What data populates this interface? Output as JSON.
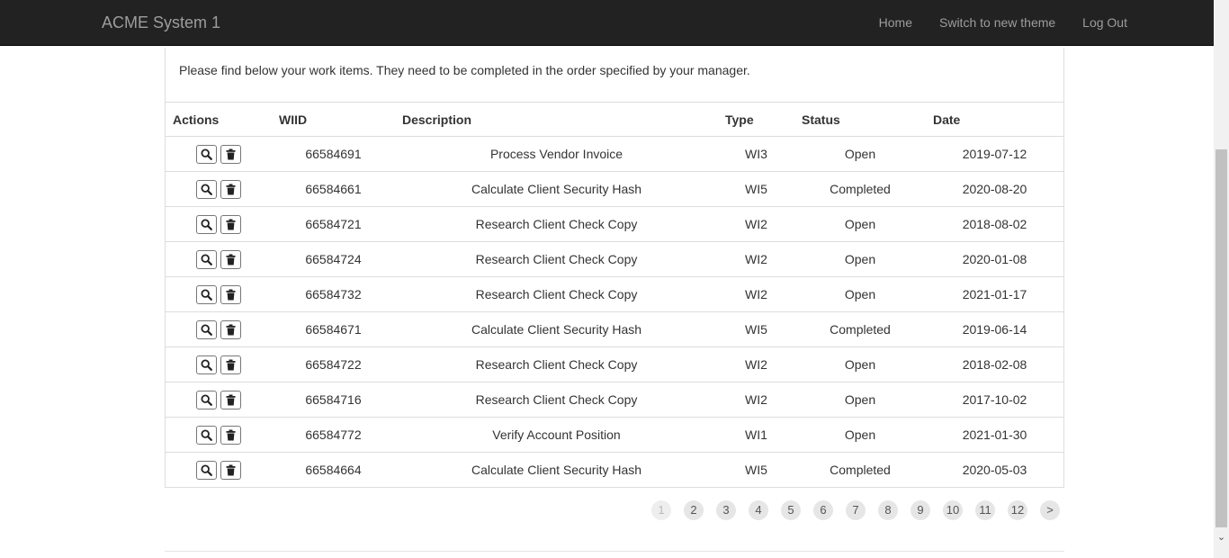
{
  "nav": {
    "brand": "ACME System 1",
    "links": [
      "Home",
      "Switch to new theme",
      "Log Out"
    ]
  },
  "intro": "Please find below your work items. They need to be completed in the order specified by your manager.",
  "table": {
    "headers": [
      "Actions",
      "WIID",
      "Description",
      "Type",
      "Status",
      "Date"
    ],
    "rows": [
      {
        "wiid": "66584691",
        "description": "Process Vendor Invoice",
        "type": "WI3",
        "status": "Open",
        "date": "2019-07-12"
      },
      {
        "wiid": "66584661",
        "description": "Calculate Client Security Hash",
        "type": "WI5",
        "status": "Completed",
        "date": "2020-08-20"
      },
      {
        "wiid": "66584721",
        "description": "Research Client Check Copy",
        "type": "WI2",
        "status": "Open",
        "date": "2018-08-02"
      },
      {
        "wiid": "66584724",
        "description": "Research Client Check Copy",
        "type": "WI2",
        "status": "Open",
        "date": "2020-01-08"
      },
      {
        "wiid": "66584732",
        "description": "Research Client Check Copy",
        "type": "WI2",
        "status": "Open",
        "date": "2021-01-17"
      },
      {
        "wiid": "66584671",
        "description": "Calculate Client Security Hash",
        "type": "WI5",
        "status": "Completed",
        "date": "2019-06-14"
      },
      {
        "wiid": "66584722",
        "description": "Research Client Check Copy",
        "type": "WI2",
        "status": "Open",
        "date": "2018-02-08"
      },
      {
        "wiid": "66584716",
        "description": "Research Client Check Copy",
        "type": "WI2",
        "status": "Open",
        "date": "2017-10-02"
      },
      {
        "wiid": "66584772",
        "description": "Verify Account Position",
        "type": "WI1",
        "status": "Open",
        "date": "2021-01-30"
      },
      {
        "wiid": "66584664",
        "description": "Calculate Client Security Hash",
        "type": "WI5",
        "status": "Completed",
        "date": "2020-05-03"
      }
    ],
    "action_icons": [
      "search-icon",
      "trash-icon"
    ]
  },
  "pagination": {
    "pages": [
      "1",
      "2",
      "3",
      "4",
      "5",
      "6",
      "7",
      "8",
      "9",
      "10",
      "11",
      "12",
      ">"
    ],
    "current": "1"
  }
}
